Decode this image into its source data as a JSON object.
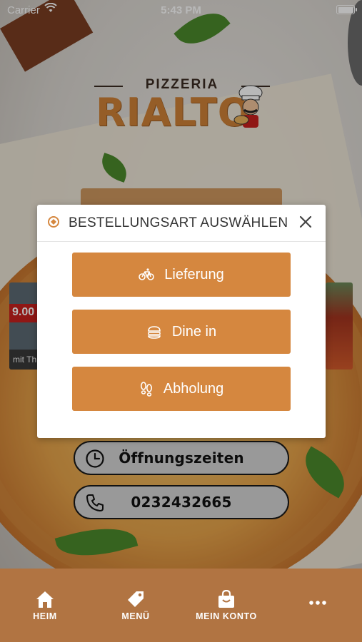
{
  "status_bar": {
    "carrier": "Carrier",
    "time": "5:43 PM"
  },
  "logo": {
    "top_text": "PIZZERIA",
    "main_text": "RIALTO"
  },
  "promo": {
    "price": "9.00",
    "caption": "mit Th"
  },
  "modal": {
    "title": "BESTELLUNGSART AUSWÄHLEN",
    "options": [
      {
        "label": "Lieferung",
        "icon": "bicycle-icon"
      },
      {
        "label": "Dine in",
        "icon": "burger-icon"
      },
      {
        "label": "Abholung",
        "icon": "footsteps-icon"
      }
    ]
  },
  "info_buttons": {
    "hours": {
      "label": "Öffnungszeiten",
      "icon": "clock-icon"
    },
    "phone": {
      "label": "0232432665",
      "icon": "phone-icon"
    }
  },
  "tabbar": {
    "items": [
      {
        "label": "HEIM",
        "icon": "home-icon"
      },
      {
        "label": "MENÜ",
        "icon": "tag-icon"
      },
      {
        "label": "MEIN KONTO",
        "icon": "bag-icon"
      },
      {
        "label": "",
        "icon": "more-icon"
      }
    ]
  },
  "colors": {
    "accent": "#d5873f",
    "tabbar": "#b17442",
    "promo_red": "#c8201e"
  }
}
